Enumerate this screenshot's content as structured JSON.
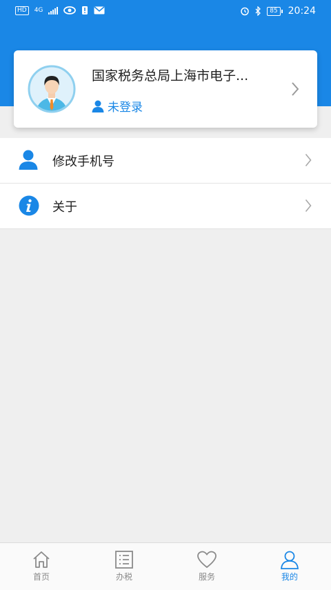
{
  "status_bar": {
    "left_badges": [
      "HD",
      "4G"
    ],
    "battery": "85",
    "time": "20:24"
  },
  "profile": {
    "org_name": "国家税务总局上海市电子...",
    "login_status": "未登录"
  },
  "menu": [
    {
      "label": "修改手机号",
      "icon": "user-icon"
    },
    {
      "label": "关于",
      "icon": "info-icon"
    }
  ],
  "tabs": [
    {
      "label": "首页",
      "icon": "home-icon",
      "active": false
    },
    {
      "label": "办税",
      "icon": "list-icon",
      "active": false
    },
    {
      "label": "服务",
      "icon": "heart-icon",
      "active": false
    },
    {
      "label": "我的",
      "icon": "user-icon",
      "active": true
    }
  ],
  "colors": {
    "accent": "#1a87e6",
    "background": "#efefef",
    "tab_inactive": "#8a8a8a"
  }
}
